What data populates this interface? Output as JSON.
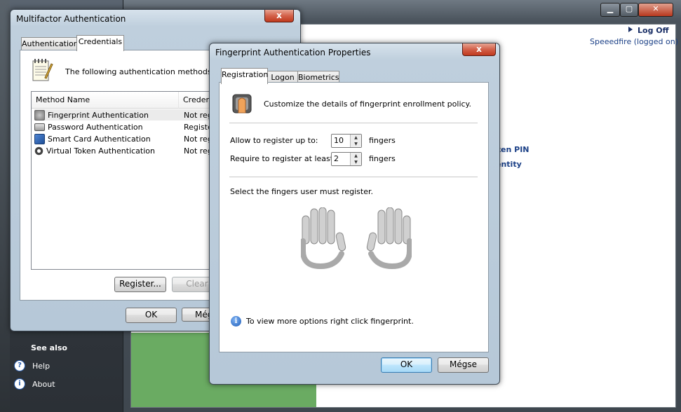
{
  "background_window": {
    "controls": [
      "▁",
      "▢",
      "✕"
    ],
    "log_off": "Log Off",
    "logged_in": "Speeedfire (logged on)",
    "link1": "ken PIN",
    "link2": "entity",
    "see_also": "See also",
    "help": "Help",
    "about": "About"
  },
  "mfa": {
    "title": "Multifactor Authentication",
    "close": "x",
    "tabs": [
      "Authentication",
      "Credentials"
    ],
    "intro": "The following authentication methods are av",
    "columns": [
      "Method Name",
      "Credenti"
    ],
    "methods": [
      {
        "name": "Fingerprint Authentication",
        "status": "Not regi"
      },
      {
        "name": "Password Authentication",
        "status": "Registe"
      },
      {
        "name": "Smart Card Authentication",
        "status": "Not regi"
      },
      {
        "name": "Virtual Token Authentication",
        "status": "Not regi"
      }
    ],
    "register": "Register...",
    "clear": "Clear",
    "ok": "OK",
    "cancel": "Még"
  },
  "fp": {
    "title": "Fingerprint Authentication Properties",
    "close": "x",
    "tabs": [
      "Registration",
      "Logon",
      "Biometrics"
    ],
    "description": "Customize the details of fingerprint enrollment policy.",
    "allow_label": "Allow to register up to:",
    "allow_value": "10",
    "require_label": "Require to register at least:",
    "require_value": "2",
    "unit": "fingers",
    "select_text": "Select the fingers user must register.",
    "info_text": "To view more options right click fingerprint.",
    "ok": "OK",
    "cancel": "Mégse"
  },
  "colors": {
    "sidebar_green": "#6aab62",
    "close_red": "#c03a1e",
    "link_blue": "#1a3f86"
  }
}
